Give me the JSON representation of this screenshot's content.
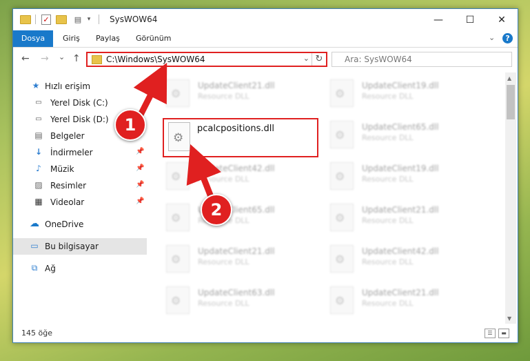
{
  "window": {
    "title": "SysWOW64",
    "minimize": "—",
    "maximize": "☐",
    "close": "✕"
  },
  "ribbon": {
    "tabs": [
      "Dosya",
      "Giriş",
      "Paylaş",
      "Görünüm"
    ],
    "help": "?"
  },
  "nav": {
    "back": "←",
    "forward": "→",
    "recent": "⌄",
    "up": "↑",
    "address": "C:\\Windows\\SysWOW64",
    "refresh": "↻",
    "search_placeholder": "Ara: SysWOW64"
  },
  "sidebar": {
    "items": [
      {
        "label": "Hızlı erişim",
        "icon": "star-icon"
      },
      {
        "label": "Yerel Disk (C:)",
        "icon": "drive-icon"
      },
      {
        "label": "Yerel Disk (D:)",
        "icon": "drive-icon"
      },
      {
        "label": "Belgeler",
        "icon": "documents-icon"
      },
      {
        "label": "İndirmeler",
        "icon": "download-icon"
      },
      {
        "label": "Müzik",
        "icon": "music-icon"
      },
      {
        "label": "Resimler",
        "icon": "pictures-icon"
      },
      {
        "label": "Videolar",
        "icon": "video-icon"
      },
      {
        "label": "OneDrive",
        "icon": "cloud-icon"
      },
      {
        "label": "Bu bilgisayar",
        "icon": "computer-icon"
      },
      {
        "label": "Ağ",
        "icon": "network-icon"
      }
    ]
  },
  "files": {
    "selected": {
      "name": "pcalcpositions.dll"
    },
    "left_column": [
      {
        "name": "UpdateClient21.dll",
        "desc": "Resource DLL"
      },
      {
        "name": "UpdateClient42.dll",
        "desc": "Resource DLL"
      },
      {
        "name": "UpdateClient65.dll",
        "desc": "Resource DLL"
      },
      {
        "name": "UpdateClient21.dll",
        "desc": "Resource DLL"
      },
      {
        "name": "UpdateClient63.dll",
        "desc": "Resource DLL"
      }
    ],
    "right_column": [
      {
        "name": "UpdateClient19.dll",
        "desc": "Resource DLL"
      },
      {
        "name": "UpdateClient65.dll",
        "desc": "Resource DLL"
      },
      {
        "name": "UpdateClient19.dll",
        "desc": "Resource DLL"
      },
      {
        "name": "UpdateClient21.dll",
        "desc": "Resource DLL"
      },
      {
        "name": "UpdateClient42.dll",
        "desc": "Resource DLL"
      },
      {
        "name": "UpdateClient21.dll",
        "desc": "Resource DLL"
      }
    ]
  },
  "status": {
    "count": "145 öğe"
  },
  "callouts": {
    "one": "1",
    "two": "2"
  },
  "colors": {
    "accent": "#1979ca",
    "highlight": "#e02020",
    "folder": "#e8c34a"
  }
}
